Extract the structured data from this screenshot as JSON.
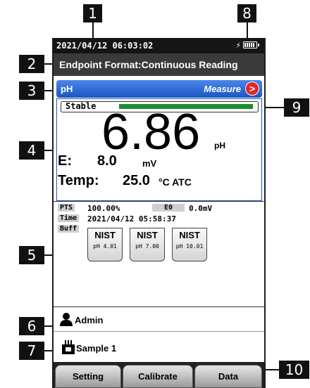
{
  "callouts": {
    "c1": "1",
    "c2": "2",
    "c3": "3",
    "c4": "4",
    "c5": "5",
    "c6": "6",
    "c7": "7",
    "c8": "8",
    "c9": "9",
    "c10": "10"
  },
  "status_bar": {
    "datetime": "2021/04/12  06:03:02",
    "charging_icon": "lightning-bolt-icon",
    "battery_icon": "battery-full-icon",
    "battery_level": 1.0
  },
  "title_bar": {
    "text": "Endpoint Format:Continuous Reading"
  },
  "mode_header": {
    "mode": "pH",
    "status": "Measure",
    "button_icon": "right-arrow-icon",
    "button_glyph": ">",
    "accent_color": "#1c56c2",
    "button_color": "#e02828"
  },
  "measurement": {
    "stable_label": "Stable",
    "stability_color": "#1b8f2f",
    "stability_fraction": 1.0,
    "value": "6.86",
    "value_unit": "pH",
    "e_label": "E:",
    "e_value": "8.0",
    "e_unit": "mV",
    "temp_label": "Temp:",
    "temp_value": "25.0",
    "temp_unit": "°C ATC"
  },
  "calibration": {
    "pts_label": "PTS",
    "pts_value": "100.00%",
    "e0_label": "E0",
    "e0_value": "0.0mV",
    "time_label": "Time",
    "time_value": "2021/04/12  05:58:37",
    "buff_label": "Buff",
    "buffers": [
      {
        "name": "NIST",
        "value": "pH 4.01"
      },
      {
        "name": "NIST",
        "value": "pH 7.00"
      },
      {
        "name": "NIST",
        "value": "pH 10.01"
      }
    ]
  },
  "user": {
    "icon": "person-icon",
    "name": "Admin"
  },
  "sample": {
    "icon": "sample-bottle-icon",
    "name": "Sample 1"
  },
  "softkeys": {
    "setting": "Setting",
    "calibrate": "Calibrate",
    "data": "Data"
  }
}
